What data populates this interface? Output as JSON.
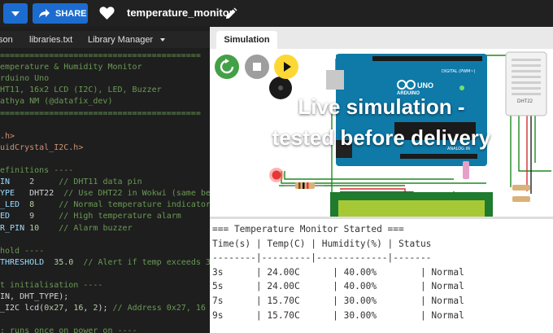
{
  "header": {
    "share_label": "SHARE",
    "project_title": "temperature_monitor"
  },
  "editor_tabs": [
    {
      "label": "son"
    },
    {
      "label": "libraries.txt"
    },
    {
      "label": "Library Manager"
    }
  ],
  "sim_tab": {
    "label": "Simulation"
  },
  "code_lines": [
    {
      "segments": [
        {
          "t": "=========================================",
          "c": "c-cmt"
        }
      ]
    },
    {
      "segments": [
        {
          "t": "emperature & Humidity Monitor",
          "c": "c-cmt"
        }
      ]
    },
    {
      "segments": [
        {
          "t": "rduino Uno",
          "c": "c-cmt"
        }
      ]
    },
    {
      "segments": [
        {
          "t": "HT11, 16x2 LCD (I2C), LED, Buzzer",
          "c": "c-cmt"
        }
      ]
    },
    {
      "segments": [
        {
          "t": "athya NM (@datafix_dev)",
          "c": "c-cmt"
        }
      ]
    },
    {
      "segments": [
        {
          "t": "=========================================",
          "c": "c-cmt"
        }
      ]
    },
    {
      "segments": [
        {
          "t": "",
          "c": "c-plain"
        }
      ]
    },
    {
      "segments": [
        {
          "t": ".h>",
          "c": "c-inc"
        }
      ]
    },
    {
      "segments": [
        {
          "t": "uidCrystal_I2C.h>",
          "c": "c-inc"
        }
      ]
    },
    {
      "segments": [
        {
          "t": "",
          "c": "c-plain"
        }
      ]
    },
    {
      "segments": [
        {
          "t": "efinitions ----",
          "c": "c-cmt"
        }
      ]
    },
    {
      "segments": [
        {
          "t": "IN",
          "c": "c-var"
        },
        {
          "t": "    ",
          "c": "c-plain"
        },
        {
          "t": "2",
          "c": "c-num"
        },
        {
          "t": "     ",
          "c": "c-plain"
        },
        {
          "t": "// DHT11 data pin",
          "c": "c-cmt"
        }
      ]
    },
    {
      "segments": [
        {
          "t": "YPE",
          "c": "c-var"
        },
        {
          "t": "   ",
          "c": "c-plain"
        },
        {
          "t": "DHT22",
          "c": "c-plain"
        },
        {
          "t": "  ",
          "c": "c-plain"
        },
        {
          "t": "// Use DHT22 in Wokwi (same beha",
          "c": "c-cmt"
        }
      ]
    },
    {
      "segments": [
        {
          "t": "_LED",
          "c": "c-var"
        },
        {
          "t": "  ",
          "c": "c-plain"
        },
        {
          "t": "8",
          "c": "c-num"
        },
        {
          "t": "     ",
          "c": "c-plain"
        },
        {
          "t": "// Normal temperature indicator",
          "c": "c-cmt"
        }
      ]
    },
    {
      "segments": [
        {
          "t": "ED",
          "c": "c-var"
        },
        {
          "t": "    ",
          "c": "c-plain"
        },
        {
          "t": "9",
          "c": "c-num"
        },
        {
          "t": "     ",
          "c": "c-plain"
        },
        {
          "t": "// High temperature alarm",
          "c": "c-cmt"
        }
      ]
    },
    {
      "segments": [
        {
          "t": "R_PIN",
          "c": "c-var"
        },
        {
          "t": " ",
          "c": "c-plain"
        },
        {
          "t": "10",
          "c": "c-num"
        },
        {
          "t": "    ",
          "c": "c-plain"
        },
        {
          "t": "// Alarm buzzer",
          "c": "c-cmt"
        }
      ]
    },
    {
      "segments": [
        {
          "t": "",
          "c": "c-plain"
        }
      ]
    },
    {
      "segments": [
        {
          "t": "hold ----",
          "c": "c-cmt"
        }
      ]
    },
    {
      "segments": [
        {
          "t": "THRESHOLD",
          "c": "c-var"
        },
        {
          "t": "  ",
          "c": "c-plain"
        },
        {
          "t": "35.0",
          "c": "c-num"
        },
        {
          "t": "  ",
          "c": "c-plain"
        },
        {
          "t": "// Alert if temp exceeds 35°",
          "c": "c-cmt"
        }
      ]
    },
    {
      "segments": [
        {
          "t": "",
          "c": "c-plain"
        }
      ]
    },
    {
      "segments": [
        {
          "t": "t initialisation ----",
          "c": "c-cmt"
        }
      ]
    },
    {
      "segments": [
        {
          "t": "IN, DHT_TYPE);",
          "c": "c-plain"
        }
      ]
    },
    {
      "segments": [
        {
          "t": "_I2C lcd(",
          "c": "c-plain"
        },
        {
          "t": "0x27",
          "c": "c-num"
        },
        {
          "t": ", ",
          "c": "c-plain"
        },
        {
          "t": "16",
          "c": "c-num"
        },
        {
          "t": ", ",
          "c": "c-plain"
        },
        {
          "t": "2",
          "c": "c-num"
        },
        {
          "t": "); ",
          "c": "c-plain"
        },
        {
          "t": "// Address 0x27, 16 col",
          "c": "c-cmt"
        }
      ]
    },
    {
      "segments": [
        {
          "t": "",
          "c": "c-plain"
        }
      ]
    },
    {
      "segments": [
        {
          "t": ": runs once on power on ----",
          "c": "c-cmt"
        }
      ]
    }
  ],
  "overlay": {
    "line1": "Live simulation -",
    "line2": "tested before delivery"
  },
  "board": {
    "brand": "ARDUINO",
    "model": "UNO",
    "digital_label": "DIGITAL (PWM~)",
    "analog_label": "ANALOG IN",
    "sensor_label": "DHT22"
  },
  "serial_lines": [
    "=== Temperature Monitor Started ===",
    "Time(s) | Temp(C) | Humidity(%) | Status",
    "--------|---------|-------------|-------",
    "3s      | 24.00C      | 40.00%        | Normal",
    "5s      | 24.00C      | 40.00%        | Normal",
    "7s      | 15.70C      | 30.00%        | Normal",
    "9s      | 15.70C      | 30.00%        | Normal"
  ],
  "colors": {
    "accent": "#1c6cd0",
    "restart": "#43a047",
    "stop": "#9e9e9e",
    "play": "#fdd835",
    "board": "#0f7aa8",
    "wire": "#1f8a1f"
  }
}
